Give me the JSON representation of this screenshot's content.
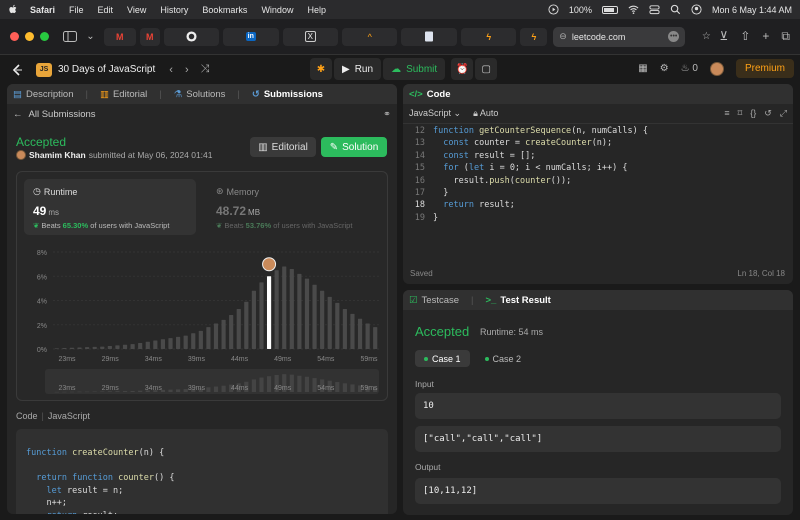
{
  "menubar": {
    "app": "Safari",
    "items": [
      "File",
      "Edit",
      "View",
      "History",
      "Bookmarks",
      "Window",
      "Help"
    ],
    "battery": "100%",
    "datetime": "Mon 6 May  1:44 AM"
  },
  "browser": {
    "url": "leetcode.com"
  },
  "lc": {
    "problem_title": "30 Days of JavaScript",
    "run_label": "Run",
    "submit_label": "Submit",
    "streak": "0",
    "premium_label": "Premium"
  },
  "left": {
    "tabs": [
      {
        "label": "Description"
      },
      {
        "label": "Editorial"
      },
      {
        "label": "Solutions"
      },
      {
        "label": "Submissions"
      }
    ],
    "back_label": "All Submissions",
    "status": "Accepted",
    "user": "Shamim Khan",
    "submitted_text": "submitted at May 06, 2024 01:41",
    "editorial_btn": "Editorial",
    "solution_btn": "Solution",
    "runtime": {
      "label": "Runtime",
      "value": "49",
      "unit": "ms",
      "beats_prefix": "Beats",
      "beats_pct": "65.30%",
      "beats_suffix": "of users with JavaScript"
    },
    "memory": {
      "label": "Memory",
      "value": "48.72",
      "unit": "MB",
      "beats_prefix": "Beats",
      "beats_pct": "53.76%",
      "beats_suffix": "of users with JavaScript"
    },
    "code_label": "Code",
    "code_lang": "JavaScript",
    "code_lines": [
      [
        {
          "t": "function ",
          "c": "kw"
        },
        {
          "t": "createCounter",
          "c": "fn"
        },
        {
          "t": "(n) {",
          "c": "pn"
        }
      ],
      [
        {
          "t": "",
          "c": "pn"
        }
      ],
      [
        {
          "t": "  ",
          "c": "pn"
        },
        {
          "t": "return ",
          "c": "kw"
        },
        {
          "t": "function ",
          "c": "kw"
        },
        {
          "t": "counter",
          "c": "fn"
        },
        {
          "t": "() {",
          "c": "pn"
        }
      ],
      [
        {
          "t": "    ",
          "c": "pn"
        },
        {
          "t": "let ",
          "c": "kw"
        },
        {
          "t": "result = n;",
          "c": "pn"
        }
      ],
      [
        {
          "t": "    n++;",
          "c": "pn"
        }
      ],
      [
        {
          "t": "    ",
          "c": "pn"
        },
        {
          "t": "return ",
          "c": "kw"
        },
        {
          "t": "result;",
          "c": "pn"
        }
      ]
    ]
  },
  "chart_data": {
    "type": "bar",
    "yticks": [
      "8%",
      "6%",
      "4%",
      "2%",
      "0%"
    ],
    "ylim": [
      0,
      8
    ],
    "xticks": [
      "23ms",
      "29ms",
      "34ms",
      "39ms",
      "44ms",
      "49ms",
      "54ms",
      "59ms"
    ],
    "values": [
      0.05,
      0.08,
      0.1,
      0.12,
      0.15,
      0.18,
      0.2,
      0.25,
      0.3,
      0.35,
      0.4,
      0.5,
      0.6,
      0.7,
      0.8,
      0.9,
      1.0,
      1.1,
      1.3,
      1.5,
      1.8,
      2.1,
      2.4,
      2.8,
      3.3,
      3.9,
      4.8,
      5.5,
      6.0,
      6.5,
      6.8,
      6.6,
      6.2,
      5.8,
      5.3,
      4.8,
      4.3,
      3.8,
      3.3,
      2.9,
      2.5,
      2.1,
      1.8
    ],
    "highlight_index": 28,
    "highlight_color": "#ffffff",
    "bar_color": "#4a4a4a"
  },
  "editor": {
    "language": "JavaScript",
    "mode": "Auto",
    "lines": [
      {
        "n": "12",
        "parts": [
          {
            "t": "function ",
            "c": "kw"
          },
          {
            "t": "getCounterSequence",
            "c": "fn"
          },
          {
            "t": "(n, numCalls) {",
            "c": "pn"
          }
        ]
      },
      {
        "n": "13",
        "parts": [
          {
            "t": "  ",
            "c": "pn"
          },
          {
            "t": "const ",
            "c": "kw"
          },
          {
            "t": "counter = ",
            "c": "pn"
          },
          {
            "t": "createCounter",
            "c": "fn"
          },
          {
            "t": "(n);",
            "c": "pn"
          }
        ]
      },
      {
        "n": "14",
        "parts": [
          {
            "t": "  ",
            "c": "pn"
          },
          {
            "t": "const ",
            "c": "kw"
          },
          {
            "t": "result = [];",
            "c": "pn"
          }
        ]
      },
      {
        "n": "15",
        "parts": [
          {
            "t": "  ",
            "c": "pn"
          },
          {
            "t": "for ",
            "c": "kw"
          },
          {
            "t": "(",
            "c": "pn"
          },
          {
            "t": "let ",
            "c": "kw"
          },
          {
            "t": "i = 0; i < numCalls; i++) {",
            "c": "pn"
          }
        ]
      },
      {
        "n": "16",
        "parts": [
          {
            "t": "    result.",
            "c": "pn"
          },
          {
            "t": "push",
            "c": "fn"
          },
          {
            "t": "(",
            "c": "pn"
          },
          {
            "t": "counter",
            "c": "fn"
          },
          {
            "t": "());",
            "c": "pn"
          }
        ]
      },
      {
        "n": "17",
        "parts": [
          {
            "t": "  }",
            "c": "pn"
          }
        ]
      },
      {
        "n": "18",
        "parts": [
          {
            "t": "  ",
            "c": "pn"
          },
          {
            "t": "return ",
            "c": "kw"
          },
          {
            "t": "result;",
            "c": "pn"
          }
        ]
      },
      {
        "n": "19",
        "parts": [
          {
            "t": "}",
            "c": "pn"
          }
        ]
      }
    ],
    "current_line": "18",
    "saved": "Saved",
    "position": "Ln 18, Col 18"
  },
  "result": {
    "tab_testcase": "Testcase",
    "tab_result": "Test Result",
    "status": "Accepted",
    "runtime": "Runtime: 54 ms",
    "cases": [
      "Case 1",
      "Case 2"
    ],
    "input_label": "Input",
    "input_1": "10",
    "input_2": "[\"call\",\"call\",\"call\"]",
    "output_label": "Output",
    "output": "[10,11,12]"
  }
}
